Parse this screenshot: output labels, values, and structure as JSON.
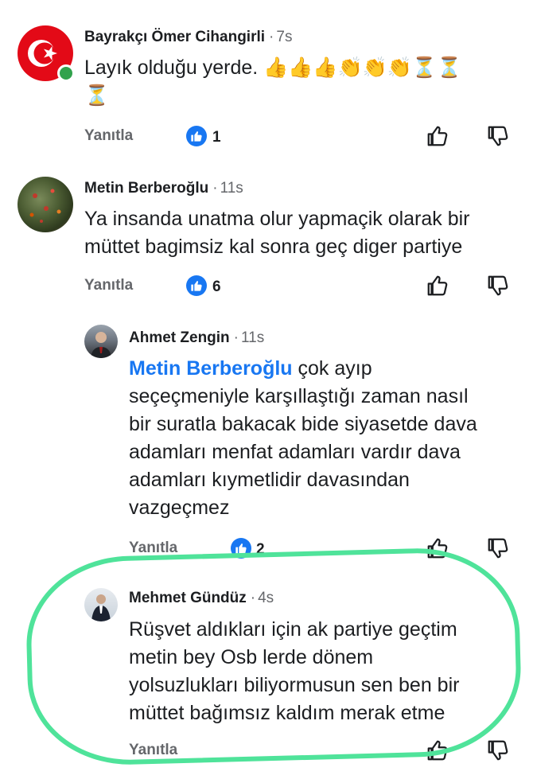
{
  "comments": [
    {
      "author": "Bayrakçı Ömer Cihangirli",
      "time": "7s",
      "text": "Layık olduğu yerde.",
      "emojis": "👍👍👍👏👏👏⏳⏳",
      "emojis_wrap": "⏳",
      "reply_label": "Yanıtla",
      "like_count": "1",
      "online": true
    },
    {
      "author": "Metin Berberoğlu",
      "time": "11s",
      "text_lines": [
        "Ya insanda unatma olur yapmaçik olarak bir",
        "müttet bagimsiz kal sonra geç diger partiye"
      ],
      "reply_label": "Yanıtla",
      "like_count": "6"
    }
  ],
  "replies": [
    {
      "author": "Ahmet Zengin",
      "time": "11s",
      "mention": "Metin Berberoğlu",
      "first_line_rest": " çok ayıp",
      "text_lines": [
        "seçeçmeniyle karşıllaştığı zaman nasıl",
        "bir suratla bakacak bide siyasetde dava",
        "adamları menfat adamları vardır dava",
        "adamları kıymetlidir davasından",
        "vazgeçmez"
      ],
      "reply_label": "Yanıtla",
      "like_count": "2"
    },
    {
      "author": "Mehmet Gündüz",
      "time": "4s",
      "text_lines": [
        "Rüşvet aldıkları için ak partiye geçtim",
        "metin bey Osb lerde dönem",
        "yolsuzlukları biliyormusun sen ben bir",
        "müttet bağımsız kaldım merak etme"
      ],
      "reply_label": "Yanıtla"
    }
  ],
  "colors": {
    "mention": "#1877f2",
    "like_badge": "#1877f2",
    "highlight": "#4fe39a",
    "online": "#31a24c"
  },
  "icons": [
    "thumbs-up-icon",
    "thumbs-down-icon",
    "like-reaction-icon"
  ]
}
